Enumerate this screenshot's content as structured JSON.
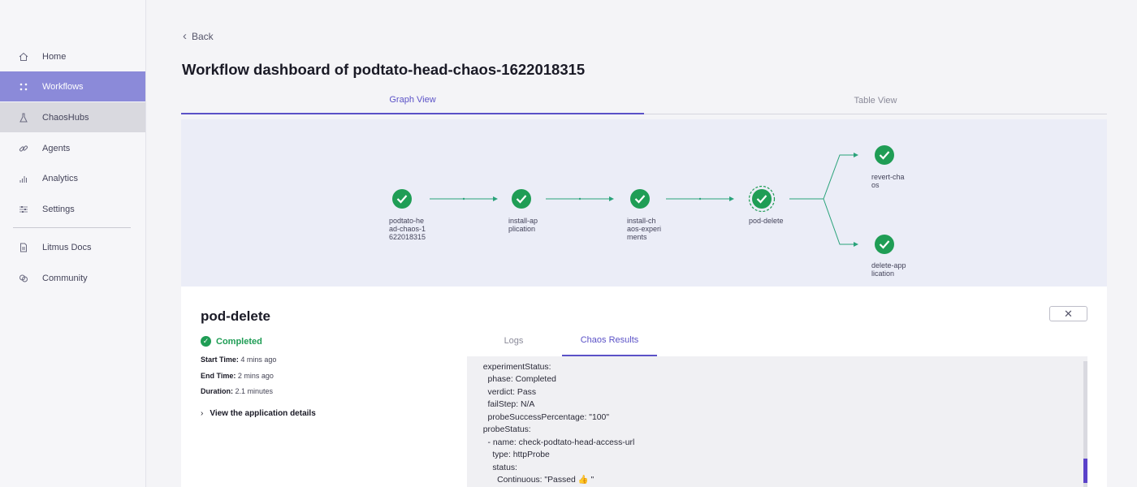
{
  "sidebar": {
    "items": [
      {
        "label": "Home",
        "icon": "home-icon"
      },
      {
        "label": "Workflows",
        "icon": "workflows-icon"
      },
      {
        "label": "ChaosHubs",
        "icon": "flask-icon"
      },
      {
        "label": "Agents",
        "icon": "link-icon"
      },
      {
        "label": "Analytics",
        "icon": "bar-chart-icon"
      },
      {
        "label": "Settings",
        "icon": "sliders-icon"
      },
      {
        "label": "Litmus Docs",
        "icon": "document-icon"
      },
      {
        "label": "Community",
        "icon": "community-icon"
      }
    ],
    "active_index": 1,
    "hover_index": 2
  },
  "header": {
    "back_label": "Back",
    "title": "Workflow dashboard of podtato-head-chaos-1622018315"
  },
  "view_tabs": {
    "graph": "Graph View",
    "table": "Table View",
    "active": "graph"
  },
  "graph": {
    "nodes": [
      {
        "id": "root",
        "label_lines": [
          "podtato-he",
          "ad-chaos-1",
          "622018315"
        ],
        "status": "completed"
      },
      {
        "id": "install-application",
        "label_lines": [
          "install-ap",
          "plication"
        ],
        "status": "completed"
      },
      {
        "id": "install-chaos-experiments",
        "label_lines": [
          "install-ch",
          "aos-experi",
          "ments"
        ],
        "status": "completed"
      },
      {
        "id": "pod-delete",
        "label_lines": [
          "pod-delete"
        ],
        "status": "completed",
        "selected": true
      },
      {
        "id": "revert-chaos",
        "label_lines": [
          "revert-cha",
          "os"
        ],
        "status": "completed"
      },
      {
        "id": "delete-application",
        "label_lines": [
          "delete-app",
          "lication"
        ],
        "status": "completed"
      }
    ],
    "colors": {
      "success": "#1f9d55",
      "edge": "#2aa37a"
    }
  },
  "node_details": {
    "name": "pod-delete",
    "status": "Completed",
    "start_label": "Start Time:",
    "start_value": "4 mins ago",
    "end_label": "End Time:",
    "end_value": "2 mins ago",
    "duration_label": "Duration:",
    "duration_value": "2.1 minutes",
    "app_details_label": "View the application details"
  },
  "result_tabs": {
    "logs": "Logs",
    "results": "Chaos Results",
    "active": "results"
  },
  "chaos_results": "status:\n  experimentStatus:\n    phase: Completed\n    verdict: Pass\n    failStep: N/A\n    probeSuccessPercentage: \"100\"\n  probeStatus:\n    - name: check-podtato-head-access-url\n      type: httpProbe\n      status:\n        Continuous: \"Passed 👍 \"",
  "colors": {
    "accent": "#5b52c7",
    "sidebar_active": "#8b8ad9",
    "success": "#1f9d55"
  }
}
